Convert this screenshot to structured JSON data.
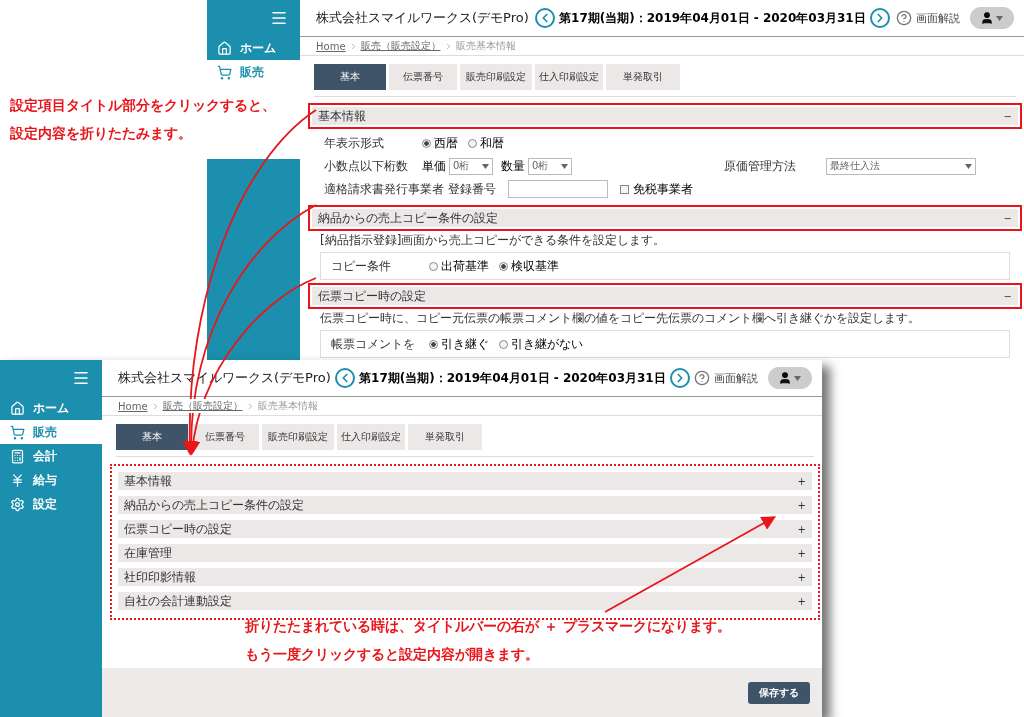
{
  "annotations": [
    {
      "kind": "top",
      "lines": [
        "設定項目タイトル部分をクリックすると、",
        "設定内容を折りたたみます。"
      ]
    },
    {
      "kind": "bottom",
      "lines": [
        "折りたたまれている時は、タイトルバーの右が ＋ プラスマークになります。",
        "もう一度クリックすると設定内容が開きます。"
      ]
    }
  ],
  "expanded_screen": {
    "company": "株式会社スマイルワークス(デモPro)",
    "period": "第17期(当期)：2019年04月01日 - 2020年03月31日",
    "help": "画面解説",
    "sidebar": [
      {
        "label": "ホーム",
        "selected": false
      },
      {
        "label": "販売",
        "selected": true
      }
    ],
    "breadcrumb": [
      "Home",
      "販売（販売設定）",
      "販売基本情報"
    ],
    "tabs": [
      {
        "label": "基本",
        "selected": true
      },
      {
        "label": "伝票番号",
        "selected": false
      },
      {
        "label": "販売印刷設定",
        "selected": false
      },
      {
        "label": "仕入印刷設定",
        "selected": false
      },
      {
        "label": "単発取引",
        "selected": false
      }
    ],
    "sections": [
      {
        "title": "基本情報",
        "toggle": "−",
        "highlighted": true,
        "rows": [
          [
            {
              "kind": "label",
              "text": "年表示形式"
            },
            {
              "kind": "radio",
              "options": [
                {
                  "label": "西暦",
                  "selected": true
                },
                {
                  "label": "和暦",
                  "selected": false
                }
              ]
            }
          ],
          [
            {
              "kind": "label",
              "text": "小数点以下桁数"
            },
            {
              "kind": "select",
              "label": "単価",
              "value": "0桁"
            },
            {
              "kind": "select",
              "label": "数量",
              "value": "0桁"
            },
            {
              "kind": "far_label",
              "text": "原価管理方法"
            },
            {
              "kind": "wide_select",
              "value": "最終仕入法"
            }
          ],
          [
            {
              "kind": "label",
              "text": "適格請求書発行事業者 登録番号"
            },
            {
              "kind": "input"
            },
            {
              "kind": "checkbox",
              "label": "免税事業者",
              "checked": false
            }
          ]
        ]
      },
      {
        "title": "納品からの売上コピー条件の設定",
        "toggle": "−",
        "highlighted": true,
        "description": "[納品指示登録]画面から売上コピーができる条件を設定します。",
        "rows": [
          [
            {
              "kind": "label",
              "text": "コピー条件"
            },
            {
              "kind": "radio",
              "options": [
                {
                  "label": "出荷基準",
                  "selected": false
                },
                {
                  "label": "検収基準",
                  "selected": true
                }
              ]
            }
          ]
        ]
      },
      {
        "title": "伝票コピー時の設定",
        "toggle": "−",
        "highlighted": true,
        "description": "伝票コピー時に、コピー元伝票の帳票コメント欄の値をコピー先伝票のコメント欄へ引き継ぐかを設定します。",
        "rows": [
          [
            {
              "kind": "label",
              "text": "帳票コメントを"
            },
            {
              "kind": "radio",
              "options": [
                {
                  "label": "引き継ぐ",
                  "selected": true
                },
                {
                  "label": "引き継がない",
                  "selected": false
                }
              ]
            }
          ]
        ]
      }
    ]
  },
  "collapsed_screen": {
    "company": "株式会社スマイルワークス(デモPro)",
    "period": "第17期(当期)：2019年04月01日 - 2020年03月31日",
    "help": "画面解説",
    "sidebar": [
      {
        "label": "ホーム",
        "selected": false
      },
      {
        "label": "販売",
        "selected": true
      },
      {
        "label": "会計",
        "selected": false
      },
      {
        "label": "給与",
        "selected": false
      },
      {
        "label": "設定",
        "selected": false
      }
    ],
    "breadcrumb": [
      "Home",
      "販売（販売設定）",
      "販売基本情報"
    ],
    "tabs": [
      {
        "label": "基本",
        "selected": true
      },
      {
        "label": "伝票番号",
        "selected": false
      },
      {
        "label": "販売印刷設定",
        "selected": false
      },
      {
        "label": "仕入印刷設定",
        "selected": false
      },
      {
        "label": "単発取引",
        "selected": false
      }
    ],
    "sections_highlighted": true,
    "sections": [
      {
        "title": "基本情報",
        "toggle": "+"
      },
      {
        "title": "納品からの売上コピー条件の設定",
        "toggle": "+"
      },
      {
        "title": "伝票コピー時の設定",
        "toggle": "+"
      },
      {
        "title": "在庫管理",
        "toggle": "+"
      },
      {
        "title": "社印印影情報",
        "toggle": "+"
      },
      {
        "title": "自社の会計連動設定",
        "toggle": "+"
      }
    ],
    "save_button": "保存する"
  }
}
